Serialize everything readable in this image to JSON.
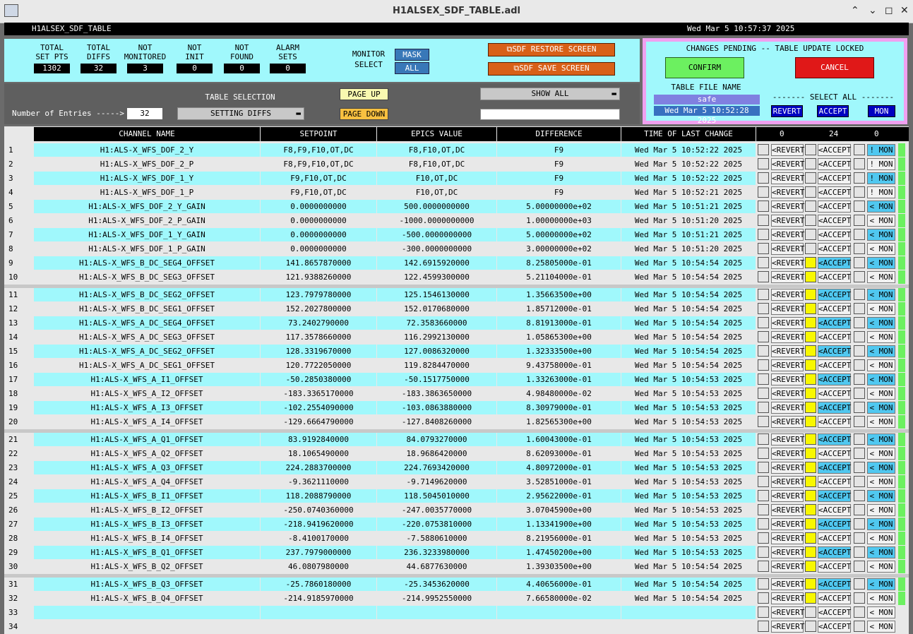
{
  "window": {
    "title": "H1ALSEX_SDF_TABLE.adl",
    "buttons": [
      "⌃",
      "⌄",
      "◻",
      "✕"
    ]
  },
  "header": {
    "screen_name": "H1ALSEX_SDF_TABLE",
    "datetime": "Wed Mar  5 10:57:37 2025"
  },
  "stats": [
    {
      "label1": "TOTAL",
      "label2": "SET PTS",
      "value": "1302"
    },
    {
      "label1": "TOTAL",
      "label2": "DIFFS",
      "value": "32"
    },
    {
      "label1": "NOT",
      "label2": "MONITORED",
      "value": "3"
    },
    {
      "label1": "NOT",
      "label2": "INIT",
      "value": "0"
    },
    {
      "label1": "NOT",
      "label2": "FOUND",
      "value": "0"
    },
    {
      "label1": "ALARM",
      "label2": "SETS",
      "value": "0"
    }
  ],
  "monitor_select": {
    "label1": "MONITOR",
    "label2": "SELECT",
    "mask": "MASK",
    "all": "ALL"
  },
  "actions": {
    "restore": "SDF RESTORE SCREEN",
    "save": "SDF SAVE SCREEN"
  },
  "pending": {
    "title": "CHANGES PENDING -- TABLE UPDATE LOCKED",
    "confirm": "CONFIRM",
    "cancel": "CANCEL",
    "table_file_label": "TABLE FILE NAME",
    "table_file": "safe",
    "table_time": "Wed Mar  5 10:52:28 2025",
    "select_all": "------- SELECT ALL -------",
    "revert": "REVERT",
    "accept": "ACCEPT",
    "mon": "MON"
  },
  "table_selection": {
    "label": "TABLE SELECTION",
    "entries_label": "Number of Entries ----->",
    "entries": "32",
    "selection": "SETTING DIFFS",
    "page_up": "PAGE UP",
    "page_down": "PAGE DOWN",
    "show_all": "SHOW ALL",
    "filter": ""
  },
  "columns": {
    "channel": "CHANNEL NAME",
    "setpoint": "SETPOINT",
    "epics": "EPICS VALUE",
    "difference": "DIFFERENCE",
    "time": "TIME OF LAST CHANGE",
    "count_revert": "0",
    "count_accept": "24",
    "count_mon": "0"
  },
  "row_buttons": {
    "revert": "<REVERT",
    "accept": "<ACCEPT",
    "mon": "< MON",
    "mon_not": "! MON"
  },
  "rows": [
    {
      "n": "1",
      "channel": "H1:ALS-X_WFS_DOF_2_Y",
      "setpoint": "F8,F9,F10,OT,DC",
      "epics": "F8,F10,OT,DC",
      "diff": "F9",
      "time": "Wed Mar  5 10:52:22 2025",
      "accept_on": false,
      "mon": "! MON"
    },
    {
      "n": "2",
      "channel": "H1:ALS-X_WFS_DOF_2_P",
      "setpoint": "F8,F9,F10,OT,DC",
      "epics": "F8,F10,OT,DC",
      "diff": "F9",
      "time": "Wed Mar  5 10:52:22 2025",
      "accept_on": false,
      "mon": "! MON"
    },
    {
      "n": "3",
      "channel": "H1:ALS-X_WFS_DOF_1_Y",
      "setpoint": "F9,F10,OT,DC",
      "epics": "F10,OT,DC",
      "diff": "F9",
      "time": "Wed Mar  5 10:52:22 2025",
      "accept_on": false,
      "mon": "! MON"
    },
    {
      "n": "4",
      "channel": "H1:ALS-X_WFS_DOF_1_P",
      "setpoint": "F9,F10,OT,DC",
      "epics": "F10,OT,DC",
      "diff": "F9",
      "time": "Wed Mar  5 10:52:21 2025",
      "accept_on": false,
      "mon": "! MON"
    },
    {
      "n": "5",
      "channel": "H1:ALS-X_WFS_DOF_2_Y_GAIN",
      "setpoint": "0.0000000000",
      "epics": "500.0000000000",
      "diff": "5.00000000e+02",
      "time": "Wed Mar  5 10:51:21 2025",
      "accept_on": false,
      "mon": "< MON"
    },
    {
      "n": "6",
      "channel": "H1:ALS-X_WFS_DOF_2_P_GAIN",
      "setpoint": "0.0000000000",
      "epics": "-1000.0000000000",
      "diff": "1.00000000e+03",
      "time": "Wed Mar  5 10:51:20 2025",
      "accept_on": false,
      "mon": "< MON"
    },
    {
      "n": "7",
      "channel": "H1:ALS-X_WFS_DOF_1_Y_GAIN",
      "setpoint": "0.0000000000",
      "epics": "-500.0000000000",
      "diff": "5.00000000e+02",
      "time": "Wed Mar  5 10:51:21 2025",
      "accept_on": false,
      "mon": "< MON"
    },
    {
      "n": "8",
      "channel": "H1:ALS-X_WFS_DOF_1_P_GAIN",
      "setpoint": "0.0000000000",
      "epics": "-300.0000000000",
      "diff": "3.00000000e+02",
      "time": "Wed Mar  5 10:51:20 2025",
      "accept_on": false,
      "mon": "< MON"
    },
    {
      "n": "9",
      "channel": "H1:ALS-X_WFS_B_DC_SEG4_OFFSET",
      "setpoint": "141.8657870000",
      "epics": "142.6915920000",
      "diff": "8.25805000e-01",
      "time": "Wed Mar  5 10:54:54 2025",
      "accept_on": true,
      "mon": "< MON"
    },
    {
      "n": "10",
      "channel": "H1:ALS-X_WFS_B_DC_SEG3_OFFSET",
      "setpoint": "121.9388260000",
      "epics": "122.4599300000",
      "diff": "5.21104000e-01",
      "time": "Wed Mar  5 10:54:54 2025",
      "accept_on": true,
      "mon": "< MON"
    },
    {
      "n": "11",
      "channel": "H1:ALS-X_WFS_B_DC_SEG2_OFFSET",
      "setpoint": "123.7979780000",
      "epics": "125.1546130000",
      "diff": "1.35663500e+00",
      "time": "Wed Mar  5 10:54:54 2025",
      "accept_on": true,
      "mon": "< MON"
    },
    {
      "n": "12",
      "channel": "H1:ALS-X_WFS_B_DC_SEG1_OFFSET",
      "setpoint": "152.2027800000",
      "epics": "152.0170680000",
      "diff": "1.85712000e-01",
      "time": "Wed Mar  5 10:54:54 2025",
      "accept_on": true,
      "mon": "< MON"
    },
    {
      "n": "13",
      "channel": "H1:ALS-X_WFS_A_DC_SEG4_OFFSET",
      "setpoint": "73.2402790000",
      "epics": "72.3583660000",
      "diff": "8.81913000e-01",
      "time": "Wed Mar  5 10:54:54 2025",
      "accept_on": true,
      "mon": "< MON"
    },
    {
      "n": "14",
      "channel": "H1:ALS-X_WFS_A_DC_SEG3_OFFSET",
      "setpoint": "117.3578660000",
      "epics": "116.2992130000",
      "diff": "1.05865300e+00",
      "time": "Wed Mar  5 10:54:54 2025",
      "accept_on": true,
      "mon": "< MON"
    },
    {
      "n": "15",
      "channel": "H1:ALS-X_WFS_A_DC_SEG2_OFFSET",
      "setpoint": "128.3319670000",
      "epics": "127.0086320000",
      "diff": "1.32333500e+00",
      "time": "Wed Mar  5 10:54:54 2025",
      "accept_on": true,
      "mon": "< MON"
    },
    {
      "n": "16",
      "channel": "H1:ALS-X_WFS_A_DC_SEG1_OFFSET",
      "setpoint": "120.7722050000",
      "epics": "119.8284470000",
      "diff": "9.43758000e-01",
      "time": "Wed Mar  5 10:54:54 2025",
      "accept_on": true,
      "mon": "< MON"
    },
    {
      "n": "17",
      "channel": "H1:ALS-X_WFS_A_I1_OFFSET",
      "setpoint": "-50.2850380000",
      "epics": "-50.1517750000",
      "diff": "1.33263000e-01",
      "time": "Wed Mar  5 10:54:53 2025",
      "accept_on": true,
      "mon": "< MON"
    },
    {
      "n": "18",
      "channel": "H1:ALS-X_WFS_A_I2_OFFSET",
      "setpoint": "-183.3365170000",
      "epics": "-183.3863650000",
      "diff": "4.98480000e-02",
      "time": "Wed Mar  5 10:54:53 2025",
      "accept_on": true,
      "mon": "< MON"
    },
    {
      "n": "19",
      "channel": "H1:ALS-X_WFS_A_I3_OFFSET",
      "setpoint": "-102.2554090000",
      "epics": "-103.0863880000",
      "diff": "8.30979000e-01",
      "time": "Wed Mar  5 10:54:53 2025",
      "accept_on": true,
      "mon": "< MON"
    },
    {
      "n": "20",
      "channel": "H1:ALS-X_WFS_A_I4_OFFSET",
      "setpoint": "-129.6664790000",
      "epics": "-127.8408260000",
      "diff": "1.82565300e+00",
      "time": "Wed Mar  5 10:54:53 2025",
      "accept_on": true,
      "mon": "< MON"
    },
    {
      "n": "21",
      "channel": "H1:ALS-X_WFS_A_Q1_OFFSET",
      "setpoint": "83.9192840000",
      "epics": "84.0793270000",
      "diff": "1.60043000e-01",
      "time": "Wed Mar  5 10:54:53 2025",
      "accept_on": true,
      "mon": "< MON"
    },
    {
      "n": "22",
      "channel": "H1:ALS-X_WFS_A_Q2_OFFSET",
      "setpoint": "18.1065490000",
      "epics": "18.9686420000",
      "diff": "8.62093000e-01",
      "time": "Wed Mar  5 10:54:53 2025",
      "accept_on": true,
      "mon": "< MON"
    },
    {
      "n": "23",
      "channel": "H1:ALS-X_WFS_A_Q3_OFFSET",
      "setpoint": "224.2883700000",
      "epics": "224.7693420000",
      "diff": "4.80972000e-01",
      "time": "Wed Mar  5 10:54:53 2025",
      "accept_on": true,
      "mon": "< MON"
    },
    {
      "n": "24",
      "channel": "H1:ALS-X_WFS_A_Q4_OFFSET",
      "setpoint": "-9.3621110000",
      "epics": "-9.7149620000",
      "diff": "3.52851000e-01",
      "time": "Wed Mar  5 10:54:53 2025",
      "accept_on": true,
      "mon": "< MON"
    },
    {
      "n": "25",
      "channel": "H1:ALS-X_WFS_B_I1_OFFSET",
      "setpoint": "118.2088790000",
      "epics": "118.5045010000",
      "diff": "2.95622000e-01",
      "time": "Wed Mar  5 10:54:53 2025",
      "accept_on": true,
      "mon": "< MON"
    },
    {
      "n": "26",
      "channel": "H1:ALS-X_WFS_B_I2_OFFSET",
      "setpoint": "-250.0740360000",
      "epics": "-247.0035770000",
      "diff": "3.07045900e+00",
      "time": "Wed Mar  5 10:54:53 2025",
      "accept_on": true,
      "mon": "< MON"
    },
    {
      "n": "27",
      "channel": "H1:ALS-X_WFS_B_I3_OFFSET",
      "setpoint": "-218.9419620000",
      "epics": "-220.0753810000",
      "diff": "1.13341900e+00",
      "time": "Wed Mar  5 10:54:53 2025",
      "accept_on": true,
      "mon": "< MON"
    },
    {
      "n": "28",
      "channel": "H1:ALS-X_WFS_B_I4_OFFSET",
      "setpoint": "-8.4100170000",
      "epics": "-7.5880610000",
      "diff": "8.21956000e-01",
      "time": "Wed Mar  5 10:54:53 2025",
      "accept_on": true,
      "mon": "< MON"
    },
    {
      "n": "29",
      "channel": "H1:ALS-X_WFS_B_Q1_OFFSET",
      "setpoint": "237.7979000000",
      "epics": "236.3233980000",
      "diff": "1.47450200e+00",
      "time": "Wed Mar  5 10:54:53 2025",
      "accept_on": true,
      "mon": "< MON"
    },
    {
      "n": "30",
      "channel": "H1:ALS-X_WFS_B_Q2_OFFSET",
      "setpoint": "46.0807980000",
      "epics": "44.6877630000",
      "diff": "1.39303500e+00",
      "time": "Wed Mar  5 10:54:54 2025",
      "accept_on": true,
      "mon": "< MON"
    },
    {
      "n": "31",
      "channel": "H1:ALS-X_WFS_B_Q3_OFFSET",
      "setpoint": "-25.7860180000",
      "epics": "-25.3453620000",
      "diff": "4.40656000e-01",
      "time": "Wed Mar  5 10:54:54 2025",
      "accept_on": true,
      "mon": "< MON"
    },
    {
      "n": "32",
      "channel": "H1:ALS-X_WFS_B_Q4_OFFSET",
      "setpoint": "-214.9185970000",
      "epics": "-214.9952550000",
      "diff": "7.66580000e-02",
      "time": "Wed Mar  5 10:54:54 2025",
      "accept_on": true,
      "mon": "< MON"
    },
    {
      "n": "33",
      "channel": "",
      "setpoint": "",
      "epics": "",
      "diff": "",
      "time": "",
      "accept_on": false,
      "mon": "< MON",
      "empty": true
    },
    {
      "n": "34",
      "channel": "",
      "setpoint": "",
      "epics": "",
      "diff": "",
      "time": "",
      "accept_on": false,
      "mon": "< MON",
      "empty": true
    }
  ],
  "colors": {
    "cyan": "#a0f8fc",
    "grey_row": "#e8e8e8",
    "orange": "#d86018",
    "green": "#6cf060",
    "red": "#e01818",
    "navy": "#0000c0",
    "yellow": "#f8f800",
    "blue_btn": "#3878b8"
  }
}
